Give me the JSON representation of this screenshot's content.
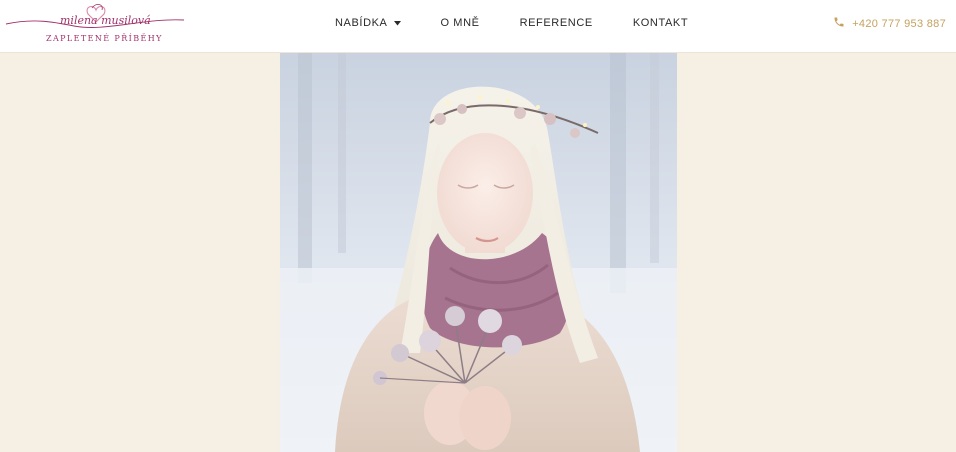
{
  "brand": {
    "name": "milena musilová",
    "tagline": "ZAPLETENÉ PŘÍBĚHY",
    "color": "#a2316b"
  },
  "nav": {
    "items": [
      {
        "label": "NABÍDKA",
        "has_dropdown": true
      },
      {
        "label": "O MNĚ",
        "has_dropdown": false
      },
      {
        "label": "REFERENCE",
        "has_dropdown": false
      },
      {
        "label": "KONTAKT",
        "has_dropdown": false
      }
    ]
  },
  "contact": {
    "phone": "+420 777 953 887",
    "icon": "phone-icon",
    "color": "#c4a25f"
  },
  "colors": {
    "page_background": "#f6efe3",
    "header_background": "#ffffff",
    "nav_text": "#2a2a2a"
  }
}
